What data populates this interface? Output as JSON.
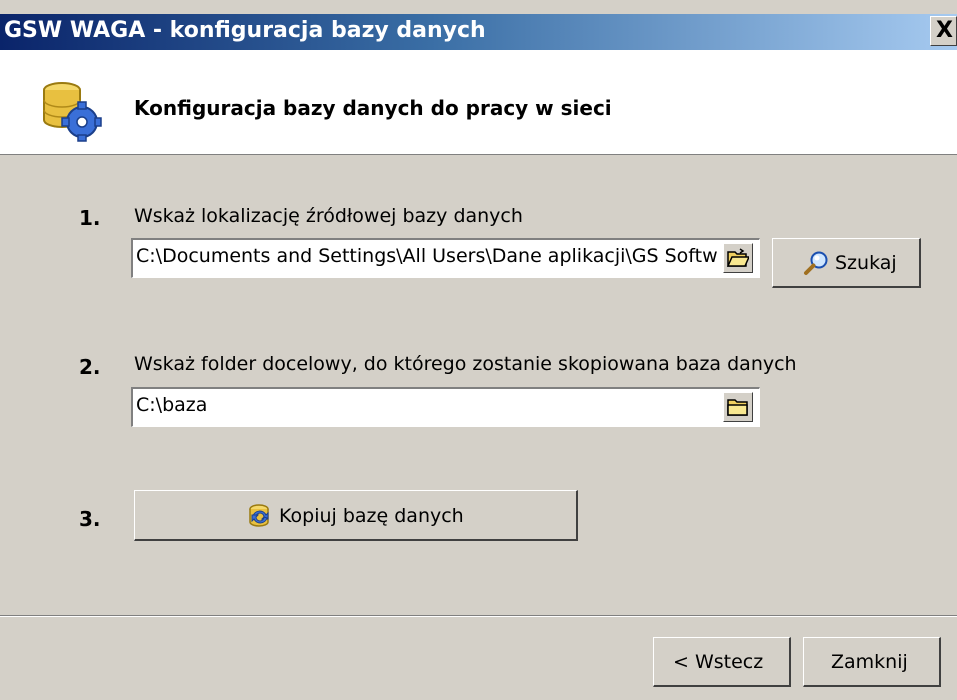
{
  "window": {
    "title": "GSW WAGA - konfiguracja bazy danych",
    "close_label": "X"
  },
  "header": {
    "title": "Konfiguracja bazy danych do pracy w sieci",
    "icon": "database-gear-icon"
  },
  "steps": [
    {
      "number": "1.",
      "label": "Wskaż lokalizację źródłowej bazy danych",
      "field_value": "C:\\Documents and Settings\\All Users\\Dane aplikacji\\GS Softw",
      "browse_icon": "open-folder-icon",
      "search_label": "Szukaj",
      "search_icon": "magnifier-icon"
    },
    {
      "number": "2.",
      "label": "Wskaż folder docelowy, do którego zostanie skopiowana baza danych",
      "field_value": "C:\\baza",
      "browse_icon": "folder-icon"
    },
    {
      "number": "3.",
      "copy_label": "Kopiuj bazę danych",
      "copy_icon": "database-copy-icon"
    }
  ],
  "footer": {
    "back_label": "< Wstecz",
    "close_label": "Zamknij"
  },
  "colors": {
    "titlebar_start": "#0a246a",
    "titlebar_end": "#a6caf0",
    "dialog_bg": "#d4d0c8"
  }
}
